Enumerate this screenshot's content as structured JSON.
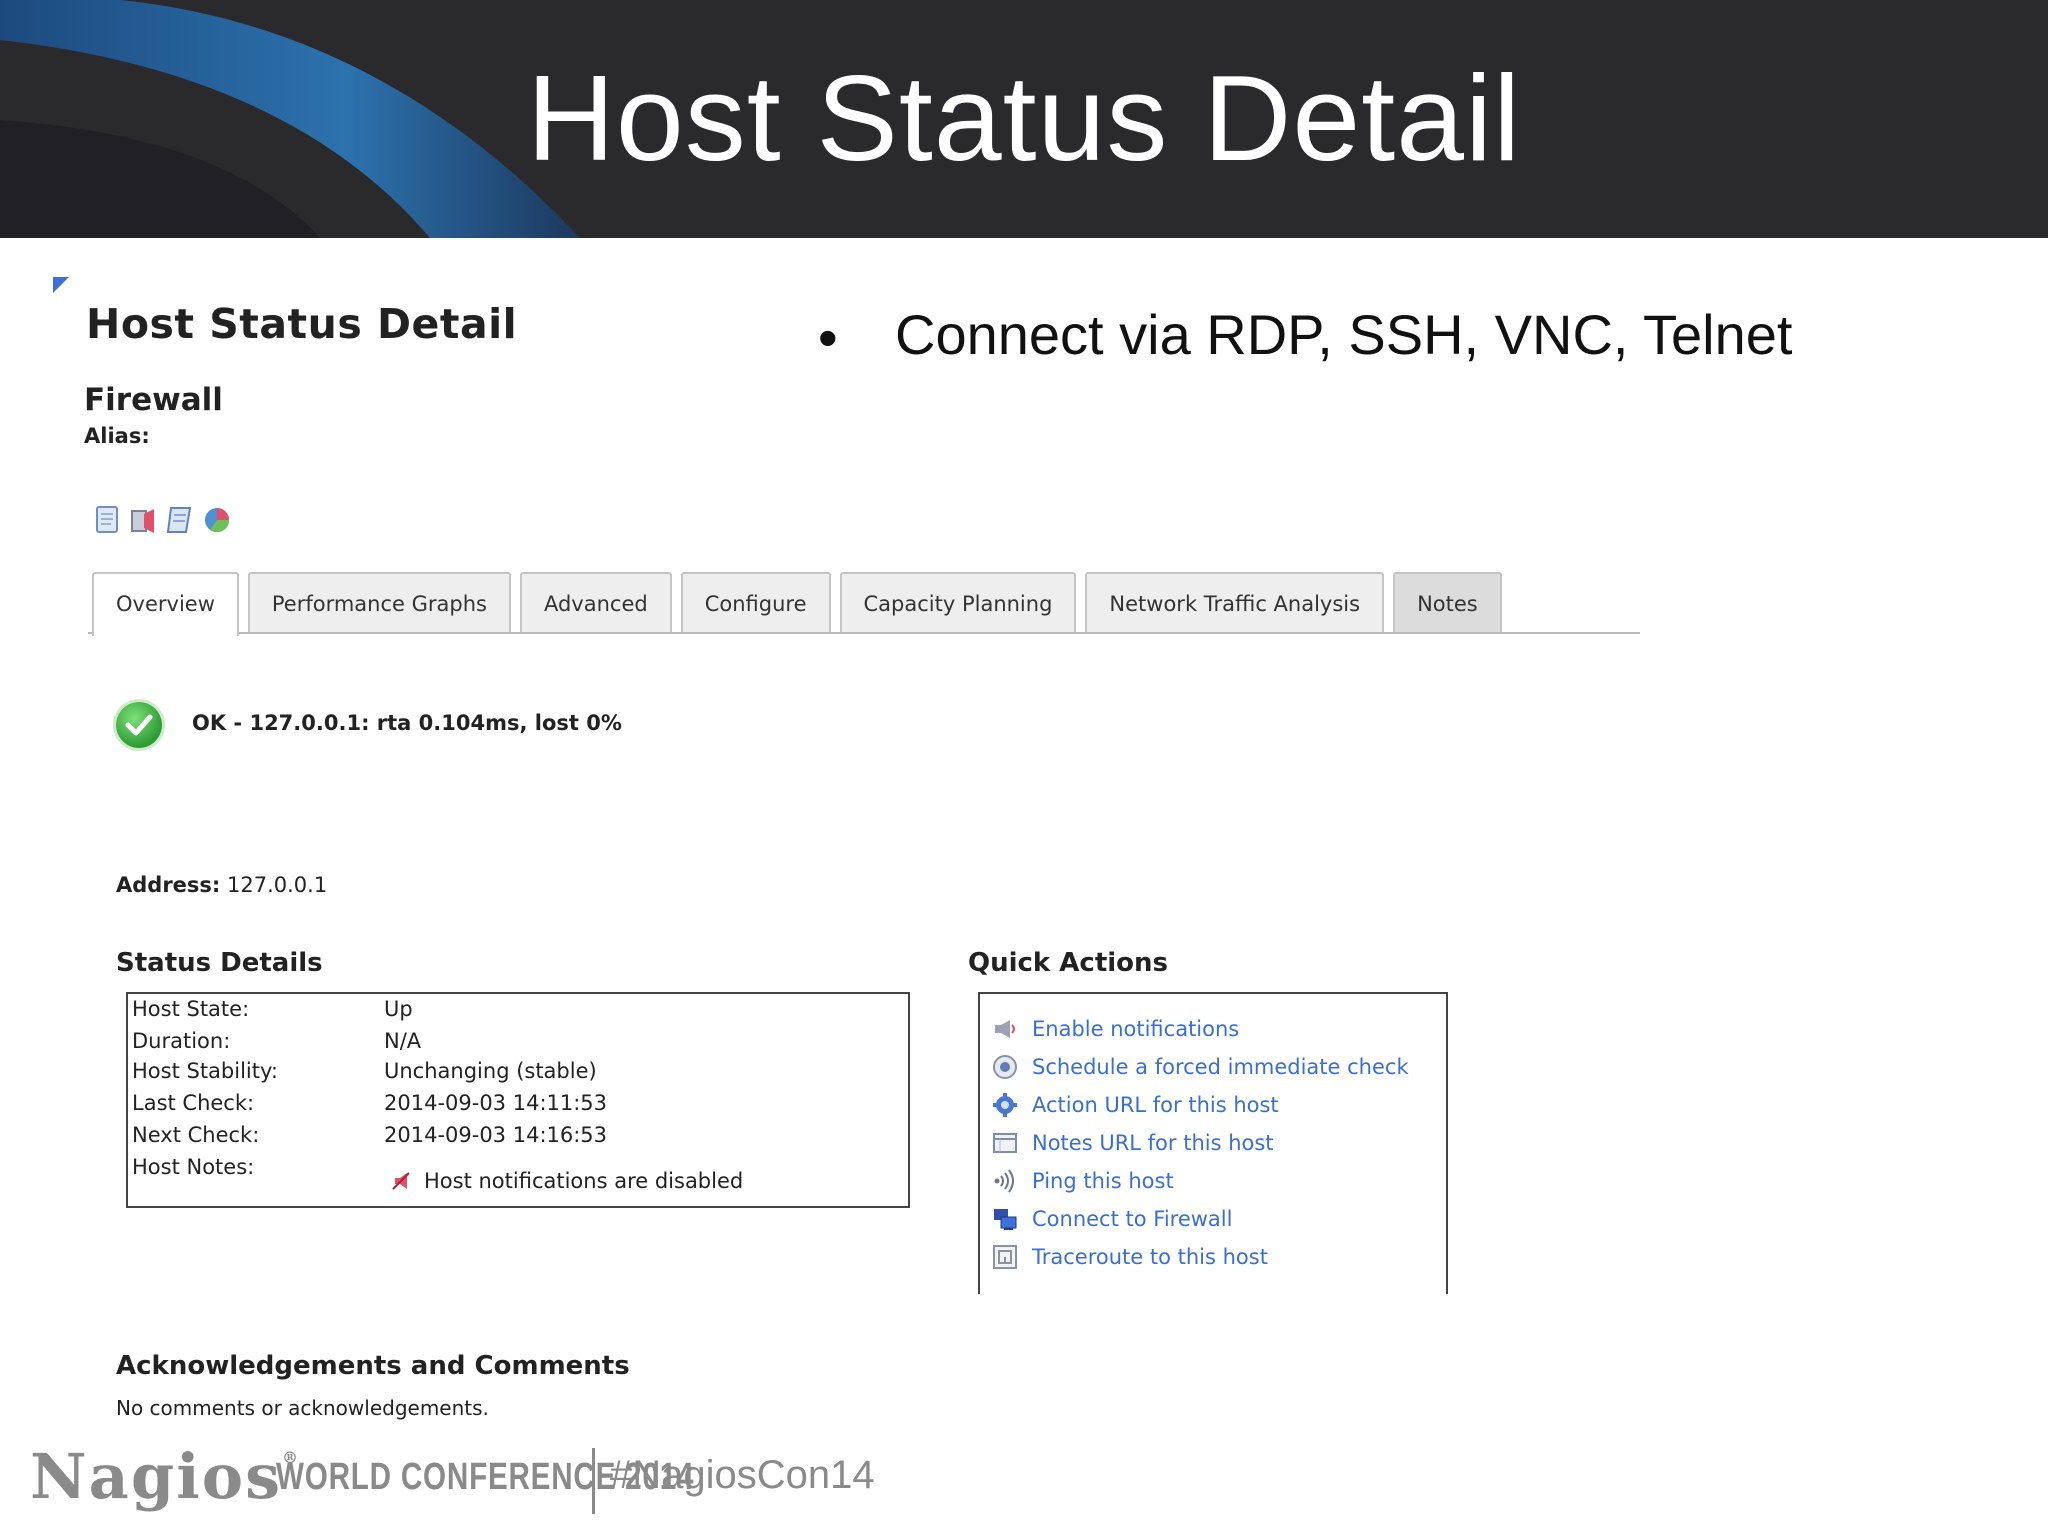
{
  "slide": {
    "title": "Host Status Detail",
    "bullet": "Connect via RDP, SSH, VNC, Telnet"
  },
  "page": {
    "heading": "Host Status Detail",
    "host_name": "Firewall",
    "alias_label": "Alias:",
    "tool_icons": [
      "document-icon",
      "notification-icon",
      "notes-icon",
      "pie-chart-icon"
    ]
  },
  "tabs": [
    {
      "label": "Overview",
      "active": true
    },
    {
      "label": "Performance Graphs",
      "active": false
    },
    {
      "label": "Advanced",
      "active": false
    },
    {
      "label": "Configure",
      "active": false
    },
    {
      "label": "Capacity Planning",
      "active": false
    },
    {
      "label": "Network Traffic Analysis",
      "active": false
    },
    {
      "label": "Notes",
      "active": false
    }
  ],
  "status": {
    "line": "OK - 127.0.0.1: rta 0.104ms, lost 0%",
    "address_label": "Address:",
    "address_value": "127.0.0.1"
  },
  "status_details": {
    "title": "Status Details",
    "rows": [
      {
        "label": "Host State:",
        "value": "Up"
      },
      {
        "label": "Duration:",
        "value": "N/A"
      },
      {
        "label": "Host Stability:",
        "value": "Unchanging (stable)"
      },
      {
        "label": "Last Check:",
        "value": "2014-09-03 14:11:53"
      },
      {
        "label": "Next Check:",
        "value": "2014-09-03 14:16:53"
      },
      {
        "label": "Host Notes:",
        "value": ""
      }
    ],
    "notifications_note": "Host notifications are disabled"
  },
  "quick_actions": {
    "title": "Quick Actions",
    "items": [
      {
        "label": "Enable notifications",
        "icon": "megaphone-icon"
      },
      {
        "label": "Schedule a forced immediate check",
        "icon": "clock-icon"
      },
      {
        "label": "Action URL for this host",
        "icon": "gear-icon"
      },
      {
        "label": "Notes URL for this host",
        "icon": "notes-icon"
      },
      {
        "label": "Ping this host",
        "icon": "ping-icon"
      },
      {
        "label": "Connect to Firewall",
        "icon": "remote-desktop-icon"
      },
      {
        "label": "Traceroute to this host",
        "icon": "traceroute-icon"
      }
    ]
  },
  "acknowledgements": {
    "title": "Acknowledgements and Comments",
    "text": "No comments or acknowledgements."
  },
  "footer": {
    "logo": "Nagios",
    "registered": "®",
    "conference": "WORLD CONFERENCE 2014",
    "hashtag": "#NagiosCon14"
  },
  "colors": {
    "link": "#3a6fd0",
    "header_bg": "#2a2a2d",
    "ok_green": "#2e9b34",
    "footer_gray": "#8a8a8a"
  }
}
